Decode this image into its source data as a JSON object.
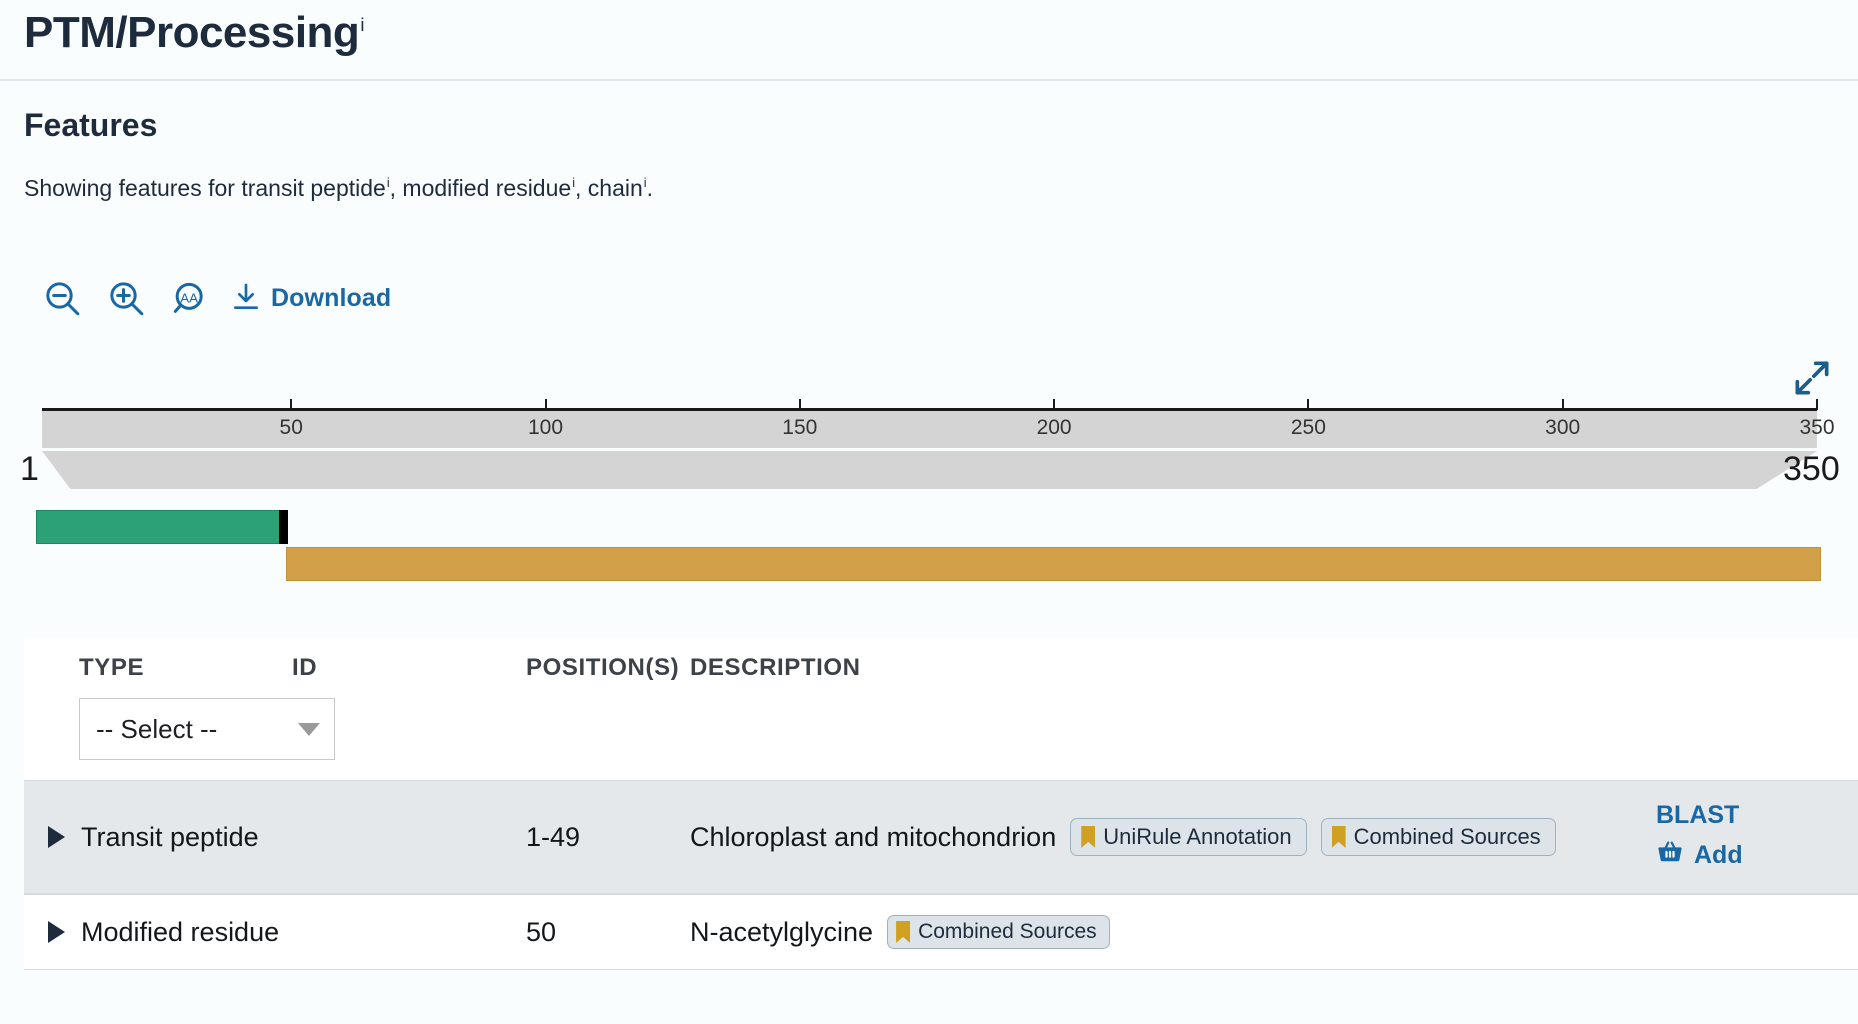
{
  "header": {
    "title": "PTM/Processing",
    "title_superscript": "i",
    "section_title": "Features",
    "showing_prefix": "Showing features for ",
    "showing_terms": [
      "transit peptide",
      "modified residue",
      "chain"
    ],
    "showing_full": "Showing features for transit peptide i, modified residue i, chain i."
  },
  "toolbar": {
    "zoom_out_icon": "zoom-out-icon",
    "zoom_in_icon": "zoom-in-icon",
    "zoom_aa_icon": "zoom-amino-acid-icon",
    "download_icon": "download-icon",
    "download_label": "Download",
    "expand_icon": "expand-fullscreen-icon"
  },
  "ruler": {
    "start_label": "1",
    "end_label": "350",
    "ticks": [
      {
        "label": "50",
        "value": 50
      },
      {
        "label": "100",
        "value": 100
      },
      {
        "label": "150",
        "value": 150
      },
      {
        "label": "200",
        "value": 200
      },
      {
        "label": "250",
        "value": 250
      },
      {
        "label": "300",
        "value": 300
      },
      {
        "label": "350",
        "value": 350
      }
    ],
    "min": 1,
    "max": 350
  },
  "tracks": [
    {
      "name": "transit-peptide-bar",
      "type": "Transit peptide",
      "start": 1,
      "end": 49,
      "color": "#2ca177"
    },
    {
      "name": "modified-residue-marker",
      "type": "Modified residue",
      "start": 50,
      "end": 50,
      "color": "#000000"
    },
    {
      "name": "chain-bar",
      "type": "Chain",
      "start": 50,
      "end": 350,
      "color": "#d3a04a"
    }
  ],
  "table": {
    "columns": {
      "type": "TYPE",
      "id": "ID",
      "positions": "POSITION(S)",
      "description": "DESCRIPTION"
    },
    "type_filter": {
      "selected": "-- Select --",
      "caret_icon": "chevron-down-icon"
    },
    "rows": [
      {
        "type": "Transit peptide",
        "id": "",
        "positions": "1-49",
        "description": "Chloroplast and mitochondrion",
        "badges": [
          "UniRule Annotation",
          "Combined Sources"
        ],
        "actions": [
          {
            "label": "BLAST",
            "icon": ""
          },
          {
            "label": "Add",
            "icon": "basket-icon"
          }
        ]
      },
      {
        "type": "Modified residue",
        "id": "",
        "positions": "50",
        "description": "N-acetylglycine",
        "badges": [
          "Combined Sources"
        ],
        "actions": []
      }
    ]
  },
  "colors": {
    "accent_blue": "#1968a4",
    "transit_green": "#2ca177",
    "chain_gold": "#d3a04a",
    "badge_gold": "#d0a022",
    "ruler_grey": "#d4d4d4",
    "row_shaded": "#e4e8eb",
    "page_bg": "#fafdfd"
  }
}
